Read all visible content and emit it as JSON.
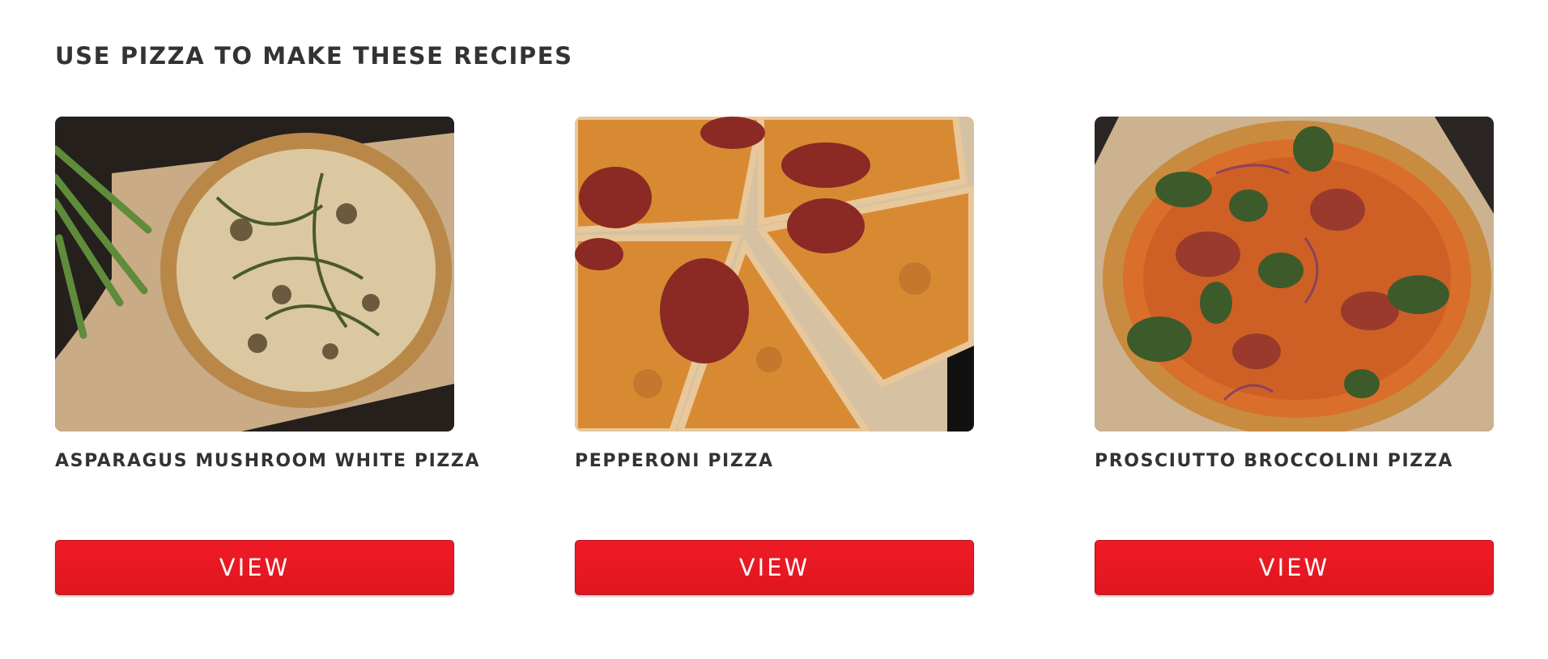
{
  "section": {
    "title": "USE PIZZA TO MAKE THESE RECIPES"
  },
  "recipes": [
    {
      "title": "ASPARAGUS MUSHROOM WHITE PIZZA",
      "button_label": "VIEW",
      "image": "asparagus-mushroom-white-pizza-photo"
    },
    {
      "title": "PEPPERONI PIZZA",
      "button_label": "VIEW",
      "image": "pepperoni-pizza-photo"
    },
    {
      "title": "PROSCIUTTO BROCCOLINI PIZZA",
      "button_label": "VIEW",
      "image": "prosciutto-broccolini-pizza-photo"
    }
  ],
  "colors": {
    "accent": "#e8161f",
    "text": "#333333",
    "background": "#ffffff"
  }
}
